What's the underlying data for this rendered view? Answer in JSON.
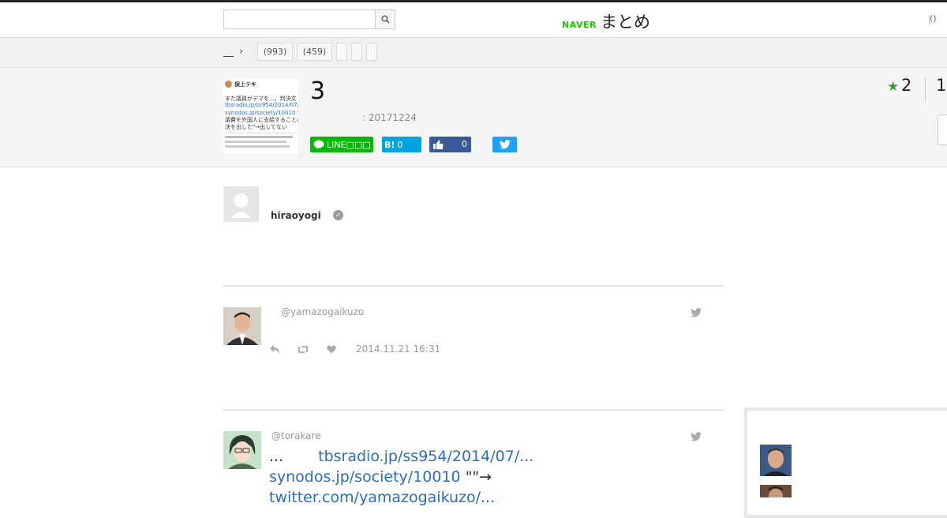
{
  "header": {
    "search_placeholder": "",
    "logo_naver": "NAVER",
    "logo_matome": "まとめ",
    "right_text": "()"
  },
  "breadcrumb": {
    "home": "__",
    "tags": [
      {
        "label": "(993)"
      },
      {
        "label": "(459)"
      },
      {
        "label": ""
      },
      {
        "label": ""
      },
      {
        "label": ""
      }
    ]
  },
  "matome": {
    "thumbnail_lines": [
      "保上テキ",
      "また議員がデマを...。判決文",
      "tbsradio.jp/ss954/2014/07/",
      "synodos.jp/society/10010 \"裁",
      "議費を外国人に支給することの",
      "決を出した\"→出してない"
    ],
    "title": "3",
    "date": ": 20171224",
    "favorites": "2",
    "views": "1",
    "share": {
      "line": "LINE□□□",
      "hatena": "B!",
      "hatena_count": "0",
      "facebook_count": "0"
    }
  },
  "author": {
    "name": "hiraoyogi"
  },
  "tweets": [
    {
      "handle": "@yamazogaikuzo",
      "time": "2014.11.21 16:31"
    },
    {
      "handle": "@torakare",
      "text_prefix": "...",
      "link1": "tbsradio.jp/ss954/2014/07/...",
      "link2": "synodos.jp/society/10010",
      "quote": " \"\"→",
      "link3": "twitter.com/yamazogaikuzo/..."
    }
  ],
  "colors": {
    "brand_green": "#1ec800",
    "link_blue": "#2a6cc0",
    "line_green": "#00b900",
    "hatena_blue": "#00a4de",
    "facebook_blue": "#3b5998",
    "twitter_blue": "#1da1f2"
  }
}
